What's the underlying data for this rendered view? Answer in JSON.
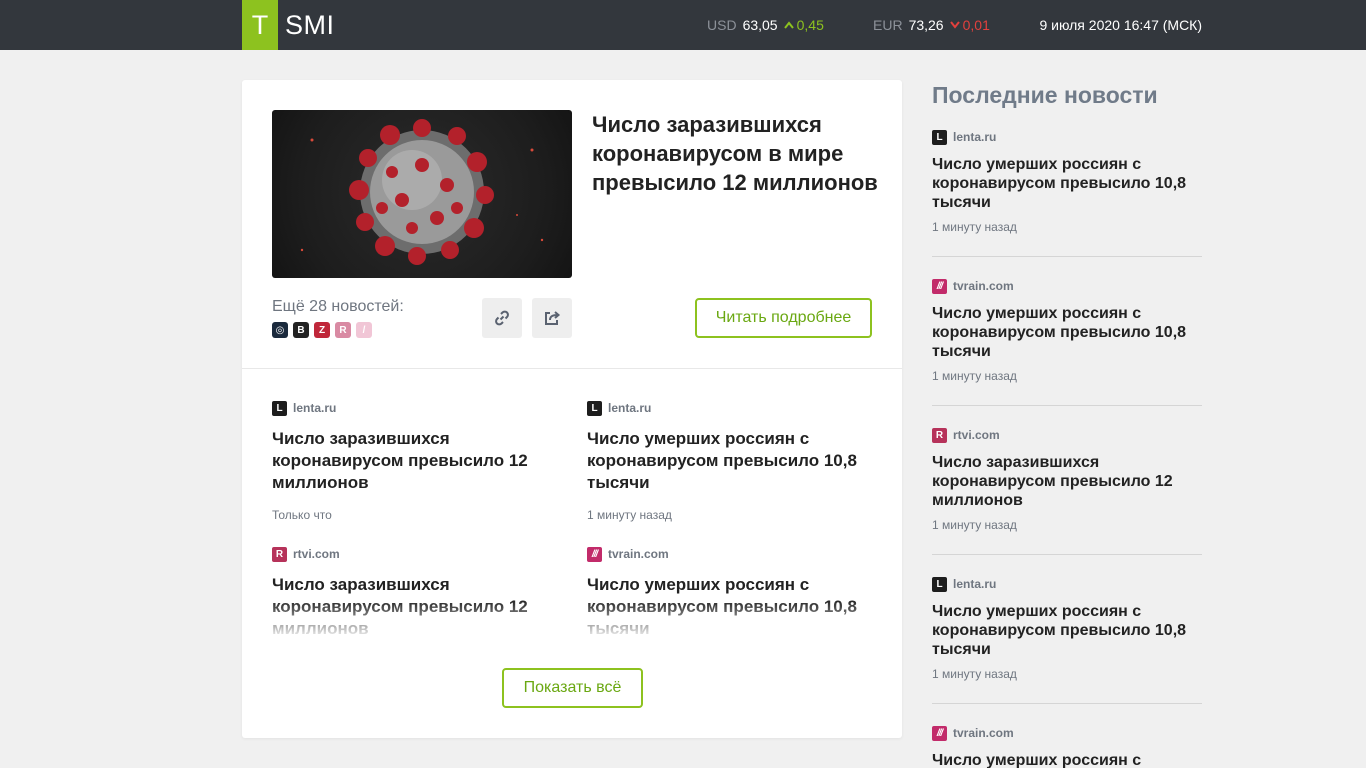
{
  "header": {
    "logo_letter": "T",
    "logo_text": "SMI",
    "usd_code": "USD",
    "usd_value": "63,05",
    "usd_change": "0,45",
    "eur_code": "EUR",
    "eur_value": "73,26",
    "eur_change": "0,01",
    "datetime": "9 июля 2020 16:47 (МСК)"
  },
  "main": {
    "hero_title": "Число заразившихся коронавирусом в мире превысило 12 миллионов",
    "more_label": "Ещё 28 новостей:",
    "read_more": "Читать подробнее",
    "show_all": "Показать всё",
    "items": [
      {
        "source": "lenta.ru",
        "badge": "L",
        "title": "Число заразившихся коронавирусом превысило 12 миллионов",
        "time": "Только что"
      },
      {
        "source": "lenta.ru",
        "badge": "L",
        "title": "Число умерших россиян с коронавирусом превысило 10,8 тысячи",
        "time": "1 минуту назад"
      },
      {
        "source": "rtvi.com",
        "badge": "R",
        "title": "Число заразившихся коронавирусом превысило 12 миллионов",
        "time": ""
      },
      {
        "source": "tvrain.com",
        "badge": "///",
        "title": "Число умерших россиян с коронавирусом превысило 10,8 тысячи",
        "time": ""
      }
    ]
  },
  "sidebar": {
    "heading": "Последние новости",
    "items": [
      {
        "source": "lenta.ru",
        "badge": "L",
        "title": "Число умерших россиян с коронавирусом превысило 10,8 тысячи",
        "time": "1 минуту назад"
      },
      {
        "source": "tvrain.com",
        "badge": "///",
        "title": "Число умерших россиян с коронавирусом превысило 10,8 тысячи",
        "time": "1 минуту назад"
      },
      {
        "source": "rtvi.com",
        "badge": "R",
        "title": "Число заразившихся коронавирусом превысило 12 миллионов",
        "time": "1 минуту назад"
      },
      {
        "source": "lenta.ru",
        "badge": "L",
        "title": "Число умерших россиян с коронавирусом превысило 10,8 тысячи",
        "time": "1 минуту назад"
      },
      {
        "source": "tvrain.com",
        "badge": "///",
        "title": "Число умерших россиян с",
        "time": ""
      }
    ]
  },
  "colors": {
    "accent": "#8dc21f",
    "header_bg": "#33373d",
    "down": "#e2403d"
  },
  "icons": [
    "link-icon",
    "share-icon",
    "arrow-up-icon",
    "arrow-down-icon"
  ]
}
